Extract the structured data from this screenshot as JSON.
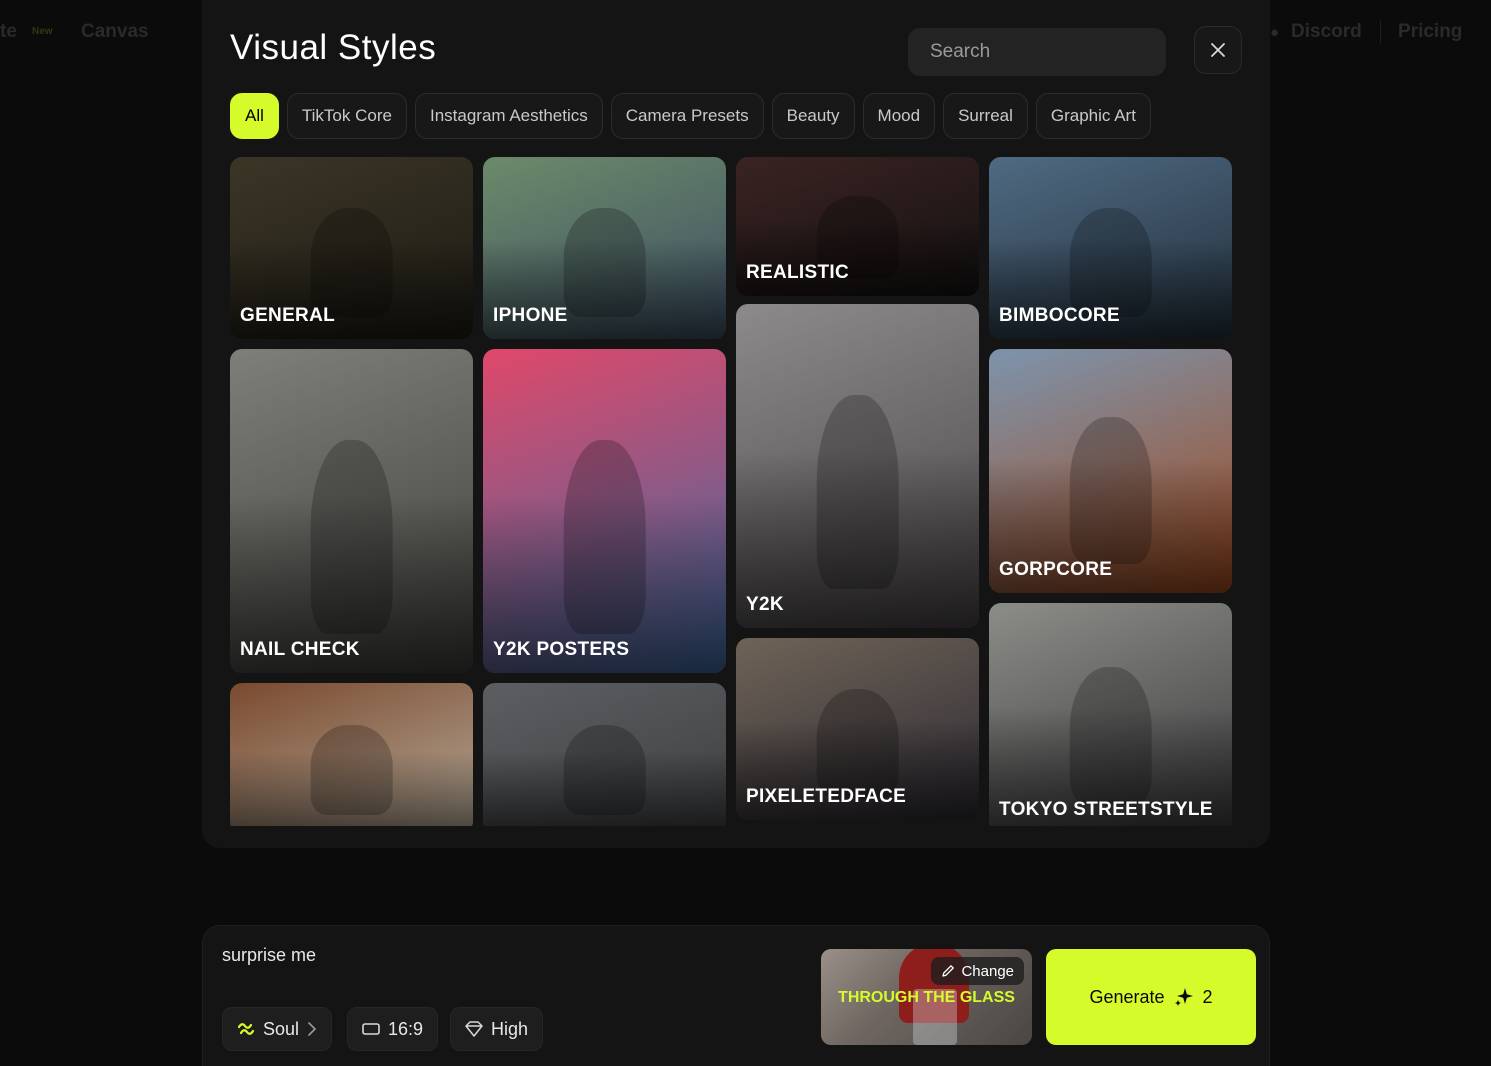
{
  "background_nav": {
    "left_partial": "te",
    "new_badge": "New",
    "canvas": "Canvas",
    "discord": "Discord",
    "pricing": "Pricing"
  },
  "modal": {
    "title": "Visual Styles",
    "search_placeholder": "Search",
    "filters": [
      "All",
      "TikTok Core",
      "Instagram Aesthetics",
      "Camera Presets",
      "Beauty",
      "Mood",
      "Surreal",
      "Graphic Art"
    ],
    "active_filter": "All"
  },
  "styles": [
    {
      "label": "GENERAL",
      "colors": [
        "#3b3526",
        "#1d1b14"
      ]
    },
    {
      "label": "IPHONE",
      "colors": [
        "#6c8a6a",
        "#3d4f63"
      ]
    },
    {
      "label": "REALISTIC",
      "colors": [
        "#3a2322",
        "#151212"
      ]
    },
    {
      "label": "BIMBOCORE",
      "colors": [
        "#4f6a82",
        "#23303c"
      ]
    },
    {
      "label": "NAIL CHECK",
      "colors": [
        "#7e7f79",
        "#3e3f3b"
      ]
    },
    {
      "label": "Y2K POSTERS",
      "colors": [
        "#e0486a",
        "#3d6aa0"
      ]
    },
    {
      "label": "Y2K",
      "colors": [
        "#8d8a8c",
        "#4a4648"
      ]
    },
    {
      "label": "GORPCORE",
      "colors": [
        "#7c94ad",
        "#a24b1f"
      ]
    },
    {
      "label": "",
      "colors": [
        "#7a4a2f",
        "#b7ab99"
      ]
    },
    {
      "label": "",
      "colors": [
        "#5c5f62",
        "#3d3e40"
      ]
    },
    {
      "label": "PIXELETEDFACE",
      "colors": [
        "#6f6357",
        "#2c2a33"
      ]
    },
    {
      "label": "TOKYO STREETSTYLE",
      "colors": [
        "#8c8c88",
        "#3a3a3c"
      ]
    }
  ],
  "prompt": {
    "text": "surprise me",
    "model": "Soul",
    "aspect_ratio": "16:9",
    "quality": "High"
  },
  "selected_style": {
    "name": "THROUGH THE GLASS",
    "change_label": "Change"
  },
  "generate": {
    "label": "Generate",
    "cost": "2"
  },
  "colors": {
    "accent": "#d5fb2b",
    "modal_bg": "#141414",
    "page_bg": "#0b0b0b"
  }
}
